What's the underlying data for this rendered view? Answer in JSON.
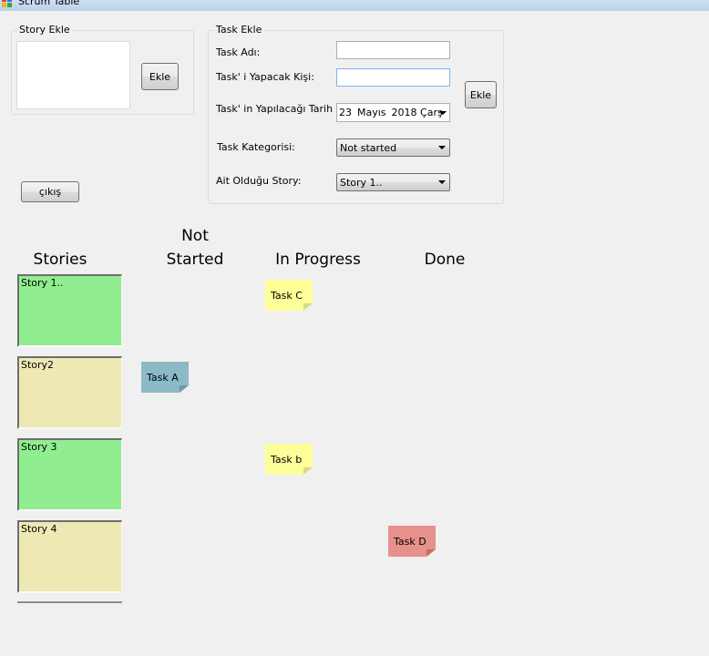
{
  "window": {
    "title": "Scrum Table"
  },
  "story_group": {
    "legend": "Story Ekle",
    "text_value": "",
    "add_button": "Ekle"
  },
  "task_group": {
    "legend": "Task Ekle",
    "name_label": "Task Adı:",
    "name_value": "",
    "assignee_label": "Task' i Yapacak Kişi:",
    "assignee_value": "",
    "date_label": "Task' in Yapılacağı Tarih",
    "date": {
      "day": "23",
      "month": "Mayıs",
      "year_day": "2018 Çarş"
    },
    "category_label": "Task Kategorisi:",
    "category_value": "Not started",
    "story_label": "Ait Olduğu Story:",
    "story_value": "Story 1..",
    "add_button": "Ekle"
  },
  "exit_button": "çıkış",
  "columns": {
    "stories": "Stories",
    "not_started_line1": "Not",
    "not_started_line2": "Started",
    "in_progress": "In Progress",
    "done": "Done"
  },
  "stories": [
    {
      "label": "Story 1..",
      "color": "#90ee90"
    },
    {
      "label": "Story2",
      "color": "#eee8b4"
    },
    {
      "label": "Story 3",
      "color": "#90ee90"
    },
    {
      "label": "Story 4",
      "color": "#eee8b4"
    }
  ],
  "tasks": [
    {
      "label": "Task C",
      "status": "In Progress",
      "color": "#ffff99",
      "fold_color": "#d9d98a"
    },
    {
      "label": "Task A",
      "status": "Not Started",
      "color": "#8bbac6",
      "fold_color": "#6c9aa6"
    },
    {
      "label": "Task b",
      "status": "In Progress",
      "color": "#ffff99",
      "fold_color": "#d9d98a"
    },
    {
      "label": "Task D",
      "status": "Done",
      "color": "#e8908c",
      "fold_color": "#c46f6b"
    }
  ],
  "icon_colors": [
    "#e04040",
    "#3a6fd0",
    "#f0b020",
    "#40a040"
  ]
}
